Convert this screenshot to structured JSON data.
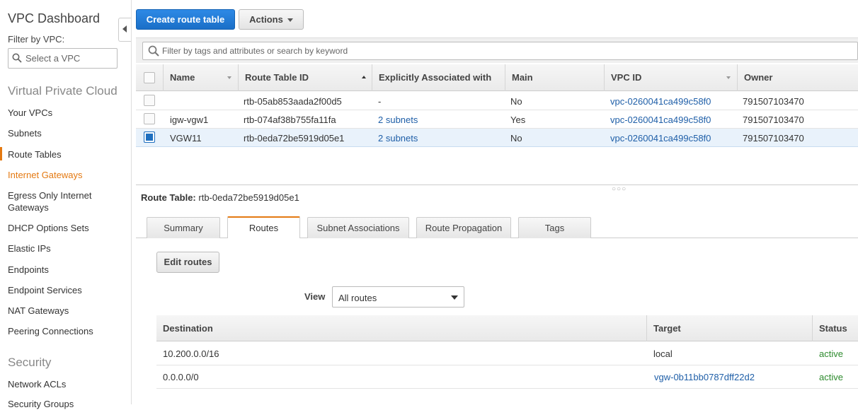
{
  "sidebar": {
    "title": "VPC Dashboard",
    "filter_label": "Filter by VPC:",
    "filter_placeholder": "Select a VPC",
    "section_vpc": "Virtual Private Cloud",
    "items": [
      {
        "label": "Your VPCs"
      },
      {
        "label": "Subnets"
      },
      {
        "label": "Route Tables"
      },
      {
        "label": "Internet Gateways"
      },
      {
        "label": "Egress Only Internet Gateways"
      },
      {
        "label": "DHCP Options Sets"
      },
      {
        "label": "Elastic IPs"
      },
      {
        "label": "Endpoints"
      },
      {
        "label": "Endpoint Services"
      },
      {
        "label": "NAT Gateways"
      },
      {
        "label": "Peering Connections"
      }
    ],
    "section_security": "Security",
    "security_items": [
      {
        "label": "Network ACLs"
      },
      {
        "label": "Security Groups"
      }
    ]
  },
  "toolbar": {
    "create_label": "Create route table",
    "actions_label": "Actions"
  },
  "search": {
    "placeholder": "Filter by tags and attributes or search by keyword"
  },
  "table": {
    "headers": {
      "name": "Name",
      "route_table_id": "Route Table ID",
      "explicit": "Explicitly Associated with",
      "main": "Main",
      "vpc_id": "VPC ID",
      "owner": "Owner"
    },
    "rows": [
      {
        "name": "",
        "id": "rtb-05ab853aada2f00d5",
        "assoc": "-",
        "main": "No",
        "vpc": "vpc-0260041ca499c58f0",
        "owner": "791507103470",
        "selected": false
      },
      {
        "name": "igw-vgw1",
        "id": "rtb-074af38b755fa11fa",
        "assoc": "2 subnets",
        "main": "Yes",
        "vpc": "vpc-0260041ca499c58f0",
        "owner": "791507103470",
        "selected": false
      },
      {
        "name": "VGW11",
        "id": "rtb-0eda72be5919d05e1",
        "assoc": "2 subnets",
        "main": "No",
        "vpc": "vpc-0260041ca499c58f0",
        "owner": "791507103470",
        "selected": true
      }
    ]
  },
  "detail": {
    "title_label": "Route Table:",
    "title_value": "rtb-0eda72be5919d05e1",
    "tabs": [
      {
        "label": "Summary"
      },
      {
        "label": "Routes"
      },
      {
        "label": "Subnet Associations"
      },
      {
        "label": "Route Propagation"
      },
      {
        "label": "Tags"
      }
    ],
    "active_tab": "Routes",
    "edit_routes_label": "Edit routes",
    "view_label": "View",
    "view_value": "All routes",
    "routes_headers": {
      "destination": "Destination",
      "target": "Target",
      "status": "Status"
    },
    "routes": [
      {
        "destination": "10.200.0.0/16",
        "target": "local",
        "status": "active"
      },
      {
        "destination": "0.0.0.0/0",
        "target": "vgw-0b11bb0787dff22d2",
        "status": "active"
      }
    ]
  },
  "colors": {
    "accent": "#e47911",
    "primary": "#1a6fc7",
    "link": "#1f5fa8",
    "active_status": "#2e8b2e"
  }
}
